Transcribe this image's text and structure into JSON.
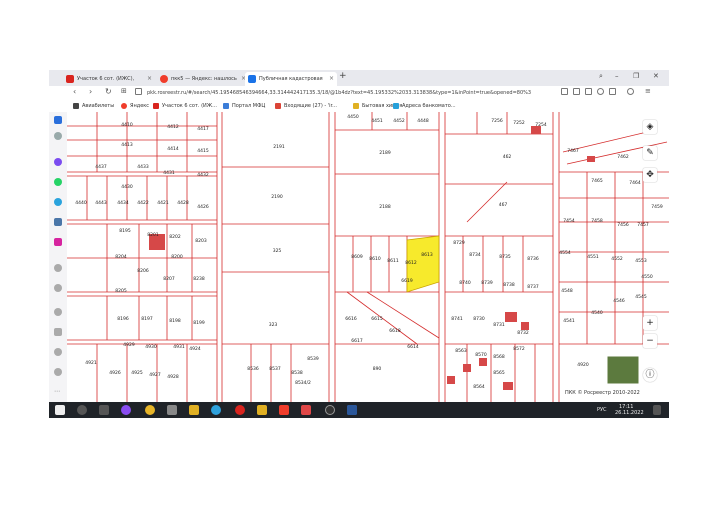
{
  "tabs": [
    {
      "label": "Участок 6 сот. (ИЖС), ",
      "color": "#d9241e"
    },
    {
      "label": "пкк5 — Яндекс: нашлось",
      "color": "#f03d2b"
    },
    {
      "label": "Публичная кадастровая",
      "color": "#1a73e8"
    }
  ],
  "address": {
    "url": "pkk.rosreestr.ru/#/search/45.195468546394664,33.314442417135.3/18/@1b4dz?text=45.195332%2033.313838&type=1&inPoint=true&opened=80%3"
  },
  "bookmarks": [
    {
      "label": "Авиабилеты",
      "color": "#444"
    },
    {
      "label": "Яндекс",
      "color": "#f03d2b"
    },
    {
      "label": "Участок 6 сот. (ИЖ...",
      "color": "#d9241e"
    },
    {
      "label": "Портал МФЦ",
      "color": "#3b7dd8"
    },
    {
      "label": "Входящие (27) - 'ir...",
      "color": "#db4437"
    },
    {
      "label": "Бытовая химия",
      "color": "#e0b023"
    },
    {
      "label": "Адреса банкомато...",
      "color": "#26a0da"
    }
  ],
  "parcels": [
    "4450",
    "4451",
    "4452",
    "4448",
    "7256",
    "7252",
    "7254",
    "4410",
    "4412",
    "4417",
    "4413",
    "4414",
    "4415",
    "2191",
    "2189",
    "462",
    "7467",
    "7462",
    "4437",
    "4431",
    "4433",
    "4432",
    "7465",
    "7464",
    "4430",
    "2190",
    "2188",
    "467",
    "4440",
    "4443",
    "4434",
    "4422",
    "4421",
    "4428",
    "4426",
    "7454",
    "7458",
    "7456",
    "7457",
    "7459",
    "8195",
    "8201",
    "8202",
    "8203",
    "325",
    "8609",
    "8610",
    "8611",
    "8612",
    "8613",
    "8729",
    "8734",
    "8735",
    "8736",
    "4554",
    "4551",
    "4552",
    "4553",
    "8204",
    "8200",
    "8206",
    "8207",
    "8238",
    "6619",
    "8740",
    "8739",
    "8738",
    "8737",
    "4548",
    "4550",
    "4546",
    "4545",
    "8205",
    "323",
    "6616",
    "6615",
    "6617",
    "8741",
    "8730",
    "8731",
    "8732",
    "4541",
    "4540",
    "8196",
    "8197",
    "8198",
    "8199",
    "6618",
    "6614",
    "4929",
    "4930",
    "4931",
    "4924",
    "4921",
    "4926",
    "4925",
    "4927",
    "4928",
    "8536",
    "8537",
    "8538",
    "8539",
    "8534/2",
    "890",
    "8563",
    "8570",
    "8568",
    "8572",
    "8565",
    "8564",
    "4920"
  ],
  "map_copyright": "ПКК © Росреестр 2010-2022",
  "tray": {
    "lang": "РУС",
    "time": "17:11",
    "date": "26.11.2022"
  },
  "selected_color": "#f7ea2c"
}
